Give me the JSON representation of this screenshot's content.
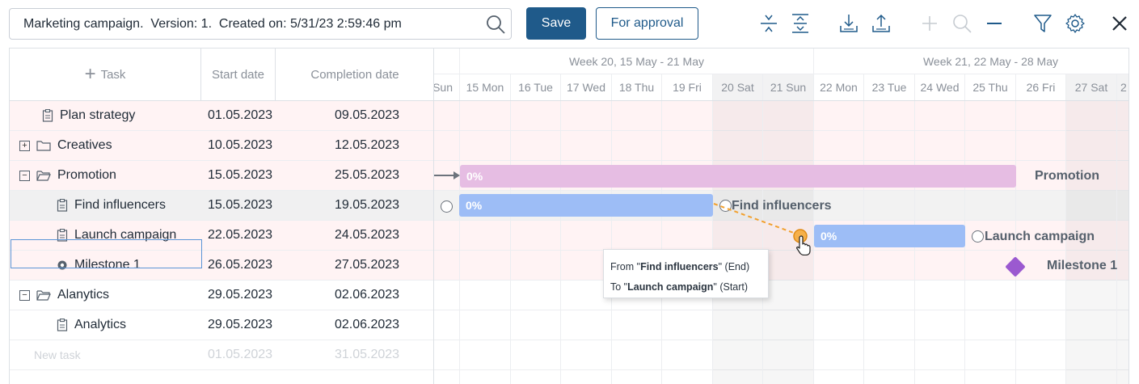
{
  "toolbar": {
    "search_value": "Marketing campaign.  Version: 1.  Created on: 5/31/23 2:59:46 pm",
    "save_label": "Save",
    "approval_label": "For approval",
    "icons": [
      "collapse-rows-icon",
      "expand-rows-icon",
      "download-icon",
      "upload-icon",
      "plus-icon",
      "zoom-in-icon",
      "zoom-out-icon",
      "filter-icon",
      "settings-icon",
      "close-icon"
    ]
  },
  "grid": {
    "headers": {
      "task": "Task",
      "start": "Start date",
      "end": "Completion date"
    },
    "rows": [
      {
        "name": "Plan strategy",
        "start": "01.05.2023",
        "end": "09.05.2023"
      },
      {
        "name": "Creatives",
        "start": "10.05.2023",
        "end": "12.05.2023"
      },
      {
        "name": "Promotion",
        "start": "15.05.2023",
        "end": "25.05.2023"
      },
      {
        "name": "Find influencers",
        "start": "15.05.2023",
        "end": "19.05.2023"
      },
      {
        "name": "Launch campaign",
        "start": "22.05.2023",
        "end": "24.05.2023"
      },
      {
        "name": "Milestone 1",
        "start": "26.05.2023",
        "end": "27.05.2023"
      },
      {
        "name": "Alanytics",
        "start": "29.05.2023",
        "end": "02.06.2023"
      },
      {
        "name": "Analytics",
        "start": "29.05.2023",
        "end": "02.06.2023"
      },
      {
        "name": "New task",
        "start": "01.05.2023",
        "end": "31.05.2023"
      }
    ]
  },
  "gantt": {
    "weeks": [
      "Week 20, 15 May - 21 May",
      "Week 21, 22 May - 28 May"
    ],
    "days": [
      "Sun",
      "15 Mon",
      "16 Tue",
      "17 Wed",
      "18 Thu",
      "19 Fri",
      "20 Sat",
      "21 Sun",
      "22 Mon",
      "23 Tue",
      "24 Wed",
      "25 Thu",
      "26 Fri",
      "27 Sat",
      "2"
    ],
    "bars": {
      "promotion_progress": "0%",
      "promotion_label": "Promotion",
      "influencers_progress": "0%",
      "influencers_label": "Find influencers",
      "launch_progress": "0%",
      "launch_label": "Launch campaign",
      "milestone_label": "Milestone 1"
    },
    "colors": {
      "summary_bar": "#e6bde3",
      "task_bar": "#9dbdf6",
      "milestone": "#9b59d0",
      "link": "#f2a02d"
    },
    "tooltip": {
      "from_prefix": "From \"",
      "from_task": "Find influencers",
      "from_suffix": "\" (End)",
      "to_prefix": "To \"",
      "to_task": "Launch campaign",
      "to_suffix": "\" (Start)"
    }
  }
}
